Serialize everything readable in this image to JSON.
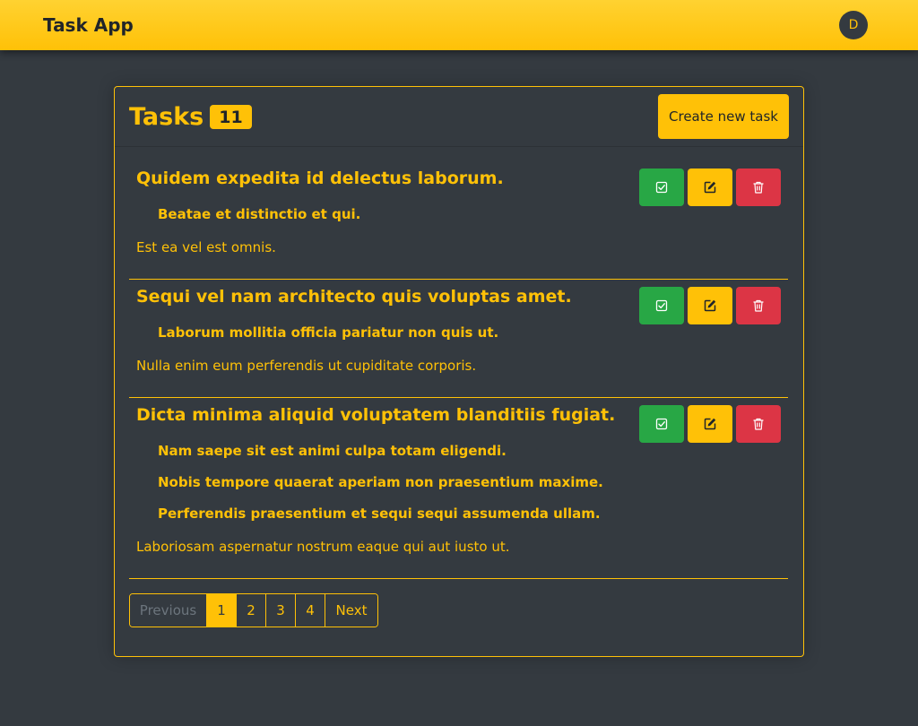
{
  "app": {
    "brand": "Task App",
    "avatar_initial": "D"
  },
  "tasks_card": {
    "title": "Tasks",
    "count": "11",
    "create_label": "Create new task"
  },
  "tasks": [
    {
      "title": "Quidem expedita id delectus laborum.",
      "subtasks": [
        "Beatae et distinctio et qui."
      ],
      "description": "Est ea vel est omnis."
    },
    {
      "title": "Sequi vel nam architecto quis voluptas amet.",
      "subtasks": [
        "Laborum mollitia officia pariatur non quis ut."
      ],
      "description": "Nulla enim eum perferendis ut cupiditate corporis."
    },
    {
      "title": "Dicta minima aliquid voluptatem blanditiis fugiat.",
      "subtasks": [
        "Nam saepe sit est animi culpa totam eligendi.",
        "Nobis tempore quaerat aperiam non praesentium maxime.",
        "Perferendis praesentium et sequi sequi assumenda ullam."
      ],
      "description": "Laboriosam aspernatur nostrum eaque qui aut iusto ut."
    }
  ],
  "pagination": {
    "previous": "Previous",
    "pages": [
      "1",
      "2",
      "3",
      "4"
    ],
    "active_page": "1",
    "next": "Next"
  },
  "icons": {
    "complete": "check-square-icon",
    "edit": "edit-icon",
    "delete": "trash-icon"
  },
  "colors": {
    "accent": "#ffc107",
    "background": "#343a40",
    "success": "#28a745",
    "danger": "#dc3545"
  }
}
